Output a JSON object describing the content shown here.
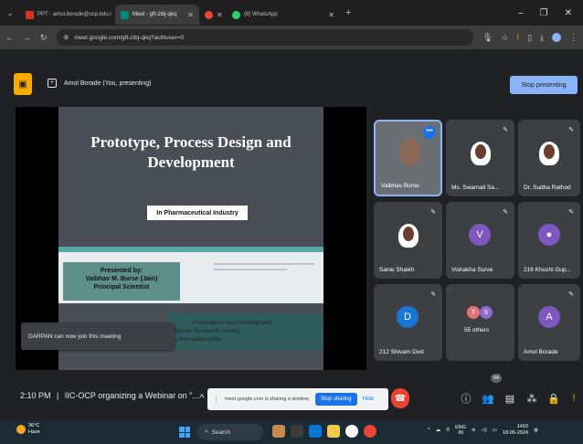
{
  "browser": {
    "tabs": [
      {
        "title": "PPT - amol.borade@ocp.edu.i",
        "fav": "#d93025"
      },
      {
        "title": "Meet - gft-zibj-qkq",
        "fav": "#00897b"
      },
      {
        "title": "",
        "fav": "#ea4335"
      },
      {
        "title": "(8) WhatsApp",
        "fav": "#25d366"
      }
    ],
    "url": "meet.google.com/gft-zibj-qkq?authuser=0"
  },
  "presenting": {
    "label": "Amol Borade (You, presenting)",
    "stop_button": "Stop presenting"
  },
  "slide": {
    "title": "Prototype, Process Design and Development",
    "subtitle": "In Pharmaceutical Industry",
    "presented_by": "Presented by:",
    "presenter": "Vaibhav M. Burse (Jain)",
    "role": "Principal Scientist",
    "detail_1": "Formulation and Development",
    "detail_2": "[Biocon Research centre],",
    "detail_3": "e, Karnataka-India"
  },
  "toast": "DARPAN can now join this meeting",
  "participants": [
    {
      "name": "Vaibhav Burse"
    },
    {
      "name": "Ms. Swarnali Sa..."
    },
    {
      "name": "Dr. Sudha Rathod"
    },
    {
      "name": "Sanie Shaikh"
    },
    {
      "name": "Vishakha Surve",
      "initial": "V",
      "color": "#7e57c2"
    },
    {
      "name": "216 Khushi Gup...",
      "initial": "",
      "color": "#7e57c2"
    },
    {
      "name": "212 Shivam Dixit",
      "initial": "D",
      "color": "#1976d2"
    },
    {
      "name": "55 others",
      "initial_a": "T",
      "initial_b": "S"
    },
    {
      "name": "Amol Borade",
      "initial": "A",
      "color": "#7e57c2"
    }
  ],
  "bottom": {
    "clock": "2:10 PM",
    "meeting_title": "IIC-OCP organizing a Webinar on \"...",
    "participant_count": "64"
  },
  "share_notice": {
    "text": "meet.google.com is sharing a window.",
    "stop": "Stop sharing",
    "hide": "Hide"
  },
  "taskbar": {
    "temp": "36°C",
    "weather": "Haze",
    "search": "Search",
    "lang_1": "ENG",
    "lang_2": "IN",
    "time": "1410",
    "date": "18-05-2024"
  }
}
